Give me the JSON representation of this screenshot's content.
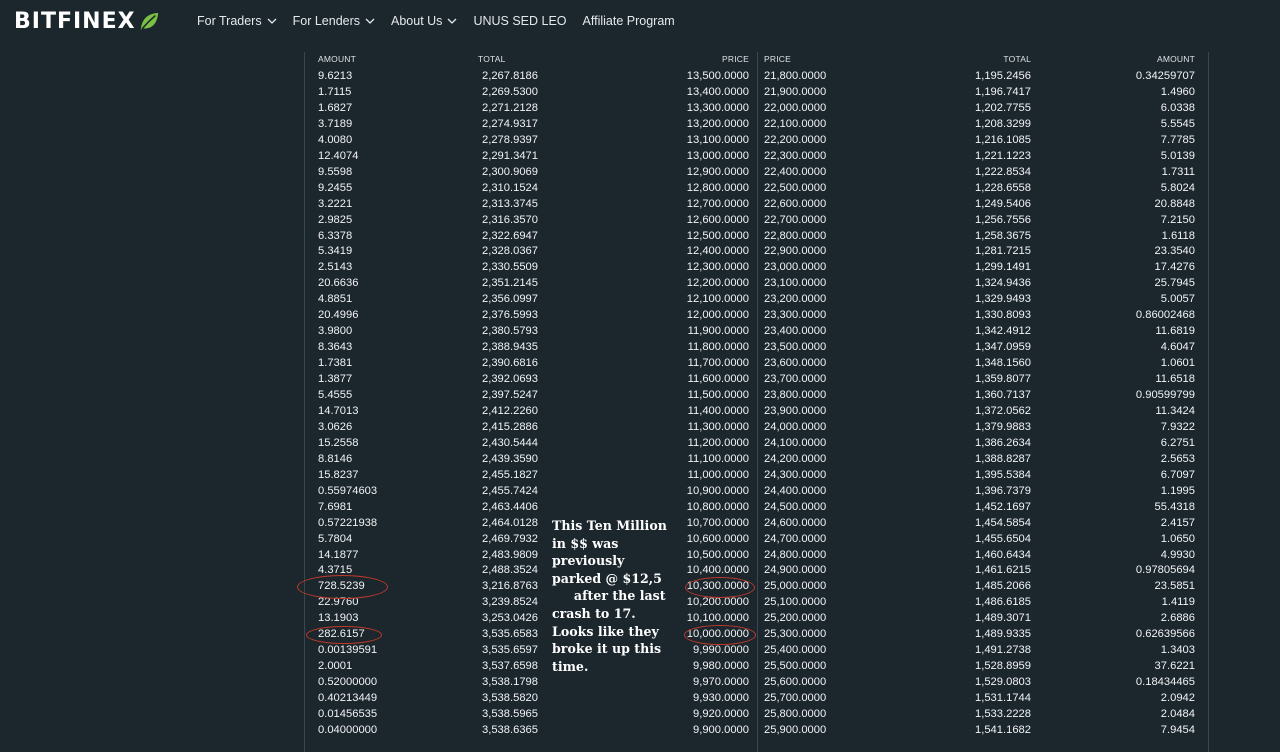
{
  "brand": {
    "name": "BITFINEX",
    "accent": "#7ac143"
  },
  "nav": {
    "items": [
      {
        "label": "For Traders",
        "dropdown": true
      },
      {
        "label": "For Lenders",
        "dropdown": true
      },
      {
        "label": "About Us",
        "dropdown": true
      },
      {
        "label": "UNUS SED LEO",
        "dropdown": false
      },
      {
        "label": "Affiliate Program",
        "dropdown": false
      }
    ]
  },
  "orderbook": {
    "headers": {
      "bids": [
        "AMOUNT",
        "TOTAL",
        "PRICE"
      ],
      "asks": [
        "PRICE",
        "TOTAL",
        "AMOUNT"
      ]
    },
    "rows": [
      [
        "9.6213",
        "2,267.8186",
        "13,500.0000",
        "21,800.0000",
        "1,195.2456",
        "0.34259707"
      ],
      [
        "1.7115",
        "2,269.5300",
        "13,400.0000",
        "21,900.0000",
        "1,196.7417",
        "1.4960"
      ],
      [
        "1.6827",
        "2,271.2128",
        "13,300.0000",
        "22,000.0000",
        "1,202.7755",
        "6.0338"
      ],
      [
        "3.7189",
        "2,274.9317",
        "13,200.0000",
        "22,100.0000",
        "1,208.3299",
        "5.5545"
      ],
      [
        "4.0080",
        "2,278.9397",
        "13,100.0000",
        "22,200.0000",
        "1,216.1085",
        "7.7785"
      ],
      [
        "12.4074",
        "2,291.3471",
        "13,000.0000",
        "22,300.0000",
        "1,221.1223",
        "5.0139"
      ],
      [
        "9.5598",
        "2,300.9069",
        "12,900.0000",
        "22,400.0000",
        "1,222.8534",
        "1.7311"
      ],
      [
        "9.2455",
        "2,310.1524",
        "12,800.0000",
        "22,500.0000",
        "1,228.6558",
        "5.8024"
      ],
      [
        "3.2221",
        "2,313.3745",
        "12,700.0000",
        "22,600.0000",
        "1,249.5406",
        "20.8848"
      ],
      [
        "2.9825",
        "2,316.3570",
        "12,600.0000",
        "22,700.0000",
        "1,256.7556",
        "7.2150"
      ],
      [
        "6.3378",
        "2,322.6947",
        "12,500.0000",
        "22,800.0000",
        "1,258.3675",
        "1.6118"
      ],
      [
        "5.3419",
        "2,328.0367",
        "12,400.0000",
        "22,900.0000",
        "1,281.7215",
        "23.3540"
      ],
      [
        "2.5143",
        "2,330.5509",
        "12,300.0000",
        "23,000.0000",
        "1,299.1491",
        "17.4276"
      ],
      [
        "20.6636",
        "2,351.2145",
        "12,200.0000",
        "23,100.0000",
        "1,324.9436",
        "25.7945"
      ],
      [
        "4.8851",
        "2,356.0997",
        "12,100.0000",
        "23,200.0000",
        "1,329.9493",
        "5.0057"
      ],
      [
        "20.4996",
        "2,376.5993",
        "12,000.0000",
        "23,300.0000",
        "1,330.8093",
        "0.86002468"
      ],
      [
        "3.9800",
        "2,380.5793",
        "11,900.0000",
        "23,400.0000",
        "1,342.4912",
        "11.6819"
      ],
      [
        "8.3643",
        "2,388.9435",
        "11,800.0000",
        "23,500.0000",
        "1,347.0959",
        "4.6047"
      ],
      [
        "1.7381",
        "2,390.6816",
        "11,700.0000",
        "23,600.0000",
        "1,348.1560",
        "1.0601"
      ],
      [
        "1.3877",
        "2,392.0693",
        "11,600.0000",
        "23,700.0000",
        "1,359.8077",
        "11.6518"
      ],
      [
        "5.4555",
        "2,397.5247",
        "11,500.0000",
        "23,800.0000",
        "1,360.7137",
        "0.90599799"
      ],
      [
        "14.7013",
        "2,412.2260",
        "11,400.0000",
        "23,900.0000",
        "1,372.0562",
        "11.3424"
      ],
      [
        "3.0626",
        "2,415.2886",
        "11,300.0000",
        "24,000.0000",
        "1,379.9883",
        "7.9322"
      ],
      [
        "15.2558",
        "2,430.5444",
        "11,200.0000",
        "24,100.0000",
        "1,386.2634",
        "6.2751"
      ],
      [
        "8.8146",
        "2,439.3590",
        "11,100.0000",
        "24,200.0000",
        "1,388.8287",
        "2.5653"
      ],
      [
        "15.8237",
        "2,455.1827",
        "11,000.0000",
        "24,300.0000",
        "1,395.5384",
        "6.7097"
      ],
      [
        "0.55974603",
        "2,455.7424",
        "10,900.0000",
        "24,400.0000",
        "1,396.7379",
        "1.1995"
      ],
      [
        "7.6981",
        "2,463.4406",
        "10,800.0000",
        "24,500.0000",
        "1,452.1697",
        "55.4318"
      ],
      [
        "0.57221938",
        "2,464.0128",
        "10,700.0000",
        "24,600.0000",
        "1,454.5854",
        "2.4157"
      ],
      [
        "5.7804",
        "2,469.7932",
        "10,600.0000",
        "24,700.0000",
        "1,455.6504",
        "1.0650"
      ],
      [
        "14.1877",
        "2,483.9809",
        "10,500.0000",
        "24,800.0000",
        "1,460.6434",
        "4.9930"
      ],
      [
        "4.3715",
        "2,488.3524",
        "10,400.0000",
        "24,900.0000",
        "1,461.6215",
        "0.97805694"
      ],
      [
        "728.5239",
        "3,216.8763",
        "10,300.0000",
        "25,000.0000",
        "1,485.2066",
        "23.5851"
      ],
      [
        "22.9760",
        "3,239.8524",
        "10,200.0000",
        "25,100.0000",
        "1,486.6185",
        "1.4119"
      ],
      [
        "13.1903",
        "3,253.0426",
        "10,100.0000",
        "25,200.0000",
        "1,489.3071",
        "2.6886"
      ],
      [
        "282.6157",
        "3,535.6583",
        "10,000.0000",
        "25,300.0000",
        "1,489.9335",
        "0.62639566"
      ],
      [
        "0.00139591",
        "3,535.6597",
        "9,990.0000",
        "25,400.0000",
        "1,491.2738",
        "1.3403"
      ],
      [
        "2.0001",
        "3,537.6598",
        "9,980.0000",
        "25,500.0000",
        "1,528.8959",
        "37.6221"
      ],
      [
        "0.52000000",
        "3,538.1798",
        "9,970.0000",
        "25,600.0000",
        "1,529.0803",
        "0.18434465"
      ],
      [
        "0.40213449",
        "3,538.5820",
        "9,930.0000",
        "25,700.0000",
        "1,531.1744",
        "2.0942"
      ],
      [
        "0.01456535",
        "3,538.5965",
        "9,920.0000",
        "25,800.0000",
        "1,533.2228",
        "2.0484"
      ],
      [
        "0.04000000",
        "3,538.6365",
        "9,900.0000",
        "25,900.0000",
        "1,541.1682",
        "7.9454"
      ]
    ]
  },
  "annotation": {
    "text": "This Ten Million\nin $$ was\npreviously\nparked @ $12,5\n     after the last\ncrash to 17.\nLooks like they\nbroke it up this\ntime.",
    "color": "#c0392b"
  }
}
